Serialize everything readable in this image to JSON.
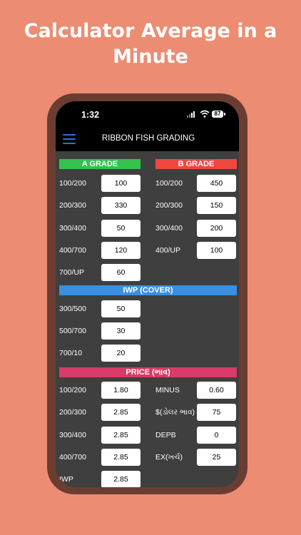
{
  "headline": {
    "line1": "Calculator Average in a",
    "line2": "Minute"
  },
  "status": {
    "time": "1:32",
    "battery": "87"
  },
  "app": {
    "title": "RIBBON FISH GRADING"
  },
  "a_grade": {
    "title": "A GRADE",
    "rows": [
      {
        "label": "100/200",
        "value": "100"
      },
      {
        "label": "200/300",
        "value": "330"
      },
      {
        "label": "300/400",
        "value": "50"
      },
      {
        "label": "400/700",
        "value": "120"
      },
      {
        "label": "700/UP",
        "value": "60"
      }
    ]
  },
  "b_grade": {
    "title": "B GRADE",
    "rows": [
      {
        "label": "100/200",
        "value": "450"
      },
      {
        "label": "200/300",
        "value": "150"
      },
      {
        "label": "300/400",
        "value": "200"
      },
      {
        "label": "400/UP",
        "value": "100"
      }
    ]
  },
  "iwp": {
    "title": "IWP (COVER)",
    "rows": [
      {
        "label": "300/500",
        "value": "50"
      },
      {
        "label": "500/700",
        "value": "30"
      },
      {
        "label": "700/10",
        "value": "20"
      }
    ]
  },
  "price": {
    "title": "PRICE (ભાવ)",
    "left": [
      {
        "label": "100/200",
        "value": "1.80"
      },
      {
        "label": "200/300",
        "value": "2.85"
      },
      {
        "label": "300/400",
        "value": "2.85"
      },
      {
        "label": "400/700",
        "value": "2.85"
      },
      {
        "label": "IWP",
        "value": "2.85"
      }
    ],
    "right": [
      {
        "label": "MINUS",
        "value": "0.60"
      },
      {
        "label": "$(ડોલર ભાવ)",
        "value": "75"
      },
      {
        "label": "DEPB",
        "value": "0"
      },
      {
        "label": "EX(ખર્ચ)",
        "value": "25"
      }
    ]
  },
  "colors": {
    "background": "#EC8C72",
    "a_grade": "#35C24E",
    "b_grade": "#F0473E",
    "iwp": "#3B8FE0",
    "price": "#D93A66",
    "menu_icon": "#2F6FE0"
  }
}
